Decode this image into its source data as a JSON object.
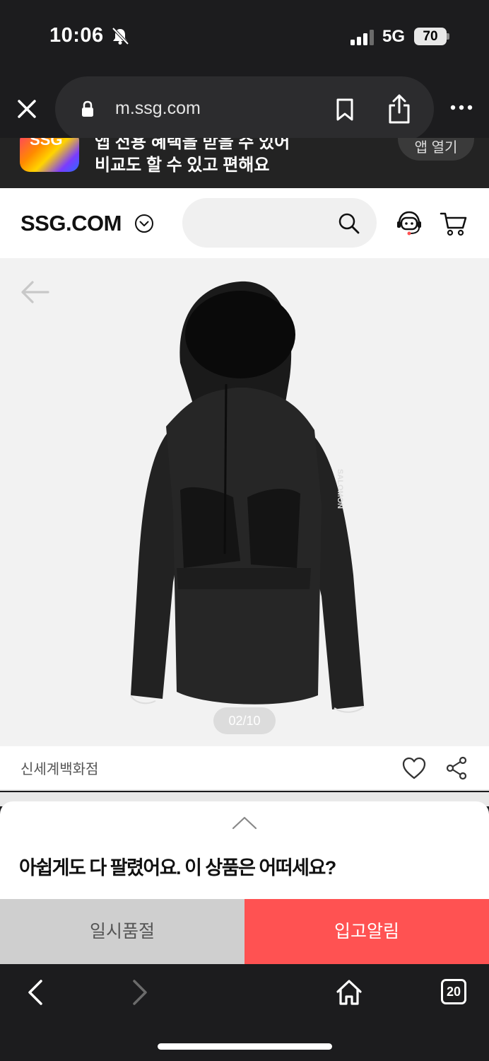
{
  "status_bar": {
    "time": "10:06",
    "network": "5G",
    "battery": "70",
    "icons": [
      "bell-slash-icon",
      "signal-icon"
    ]
  },
  "browser": {
    "url": "m.ssg.com",
    "tab_count": "20",
    "icons": [
      "close-icon",
      "lock-icon",
      "bookmark-icon",
      "share-icon",
      "more-icon",
      "back-icon",
      "forward-icon",
      "home-icon"
    ]
  },
  "app_banner": {
    "text_line1": "앱 전용 혜택을 받을 수 있어",
    "text_line2": "비교도 할 수 있고 편해요",
    "button": "앱 열기",
    "app_icon_label": "SSG"
  },
  "header": {
    "logo": "SSG.COM",
    "search_placeholder": "",
    "icons": [
      "chevron-down-icon",
      "search-icon",
      "customer-service-icon",
      "cart-icon"
    ]
  },
  "product": {
    "image_counter": "02/10",
    "brand_on_sleeve": "SALOMON",
    "seller": "신세계백화점",
    "icons": [
      "back-arrow-icon",
      "heart-icon",
      "share-icon"
    ]
  },
  "sold_out_sheet": {
    "title": "아쉽게도 다 팔렸어요. 이 상품은 어떠세요?",
    "soldout_label": "일시품절",
    "notify_label": "입고알림"
  },
  "colors": {
    "accent": "#ff5252",
    "dark": "#1c1c1e",
    "soldout": "#cfcfcf"
  }
}
